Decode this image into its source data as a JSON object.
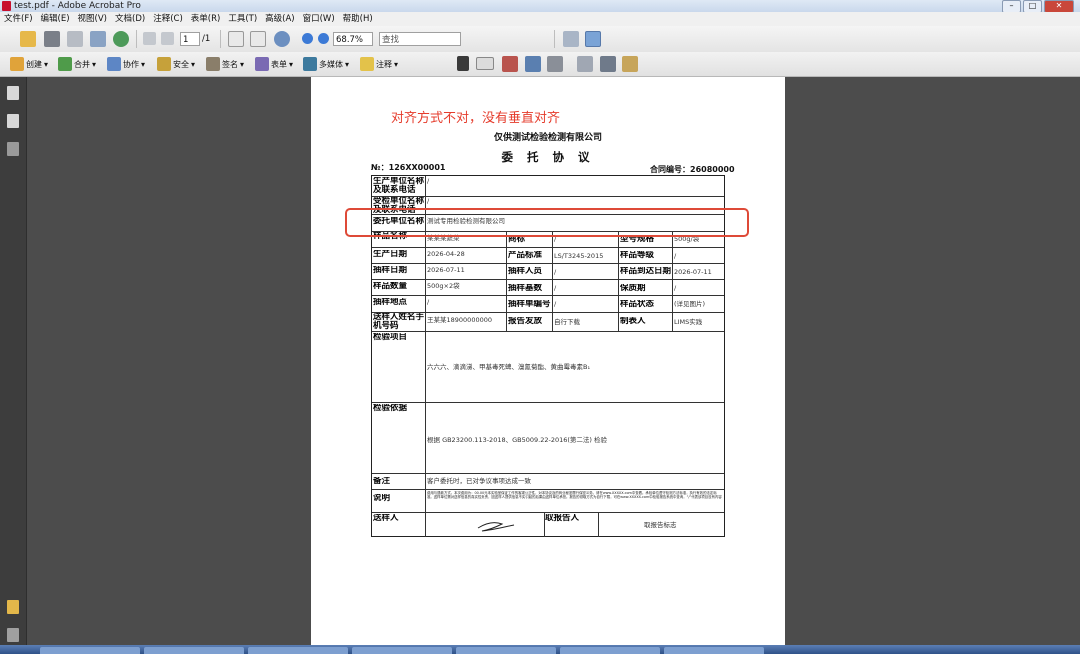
{
  "window": {
    "title": "test.pdf - Adobe Acrobat Pro",
    "minimize": "–",
    "maximize": "□",
    "close": "✕"
  },
  "menu": [
    "文件(F)",
    "编辑(E)",
    "视图(V)",
    "文档(D)",
    "注释(C)",
    "表单(R)",
    "工具(T)",
    "高级(A)",
    "窗口(W)",
    "帮助(H)"
  ],
  "toolbar": {
    "page_current": "1",
    "page_total": "/1",
    "zoom": "68.7%",
    "search_placeholder": "查找",
    "buttons": [
      "创建",
      "合并",
      "协作",
      "安全",
      "签名",
      "表单",
      "多媒体",
      "注释"
    ]
  },
  "annotation": "对齐方式不对，没有垂直对齐",
  "document": {
    "company": "仅供测试检验检测有限公司",
    "title": "委 托 协 议",
    "number": "№：126XX00001",
    "contract": "合同编号：26080000",
    "rows": {
      "producer": "生产单位名称及联系电话",
      "producer_val": "/",
      "inspected": "受检单位名称及联系电话",
      "inspected_val": "/",
      "client": "委托单位名称",
      "client_val": "测试专用检验检测有限公司",
      "sample_name": "样品名称",
      "sample_name_val": "某某某蔬菜",
      "trademark": "商标",
      "trademark_val": "/",
      "spec": "型号规格",
      "spec_val": "500g/袋",
      "prod_date": "生产日期",
      "prod_date_val": "2026-04-28",
      "standard": "产品标准",
      "standard_val": "LS/T3245-2015",
      "grade": "样品等级",
      "grade_val": "/",
      "sampling_date": "抽样日期",
      "sampling_date_val": "2026-07-11",
      "sampler": "抽样人员",
      "sampler_val": "/",
      "arrival": "样品到达日期",
      "arrival_val": "2026-07-11",
      "qty": "样品数量",
      "qty_val": "500g×2袋",
      "base": "抽样基数",
      "base_val": "/",
      "shelf": "保质期",
      "shelf_val": "/",
      "place": "抽样地点",
      "place_val": "/",
      "form_no": "抽样单编号",
      "form_no_val": "/",
      "state": "样品状态",
      "state_val": "(详见图片)",
      "sender_name": "送样人姓名手机号码",
      "sender_name_val": "王某某18900000000",
      "report": "报告发放",
      "report_val": "自行下载",
      "maker": "制表人",
      "maker_val": "LIMS实践",
      "items": "检验项目",
      "items_val": "六六六、滴滴涕、甲基毒死蜱、溴氰菊酯、黄曲霉毒素B₁",
      "basis": "检验依据",
      "basis_val": "根据 GB23200.113-2018、GB5009.22-2016(第二法) 检验",
      "remark": "备注",
      "remark_val": "客户委托时，已对争议事项达成一致",
      "note": "说明",
      "note_val": "费用与退款方式。本次费用为：00.00元本实验室保证工作的客观公正性，对本协议及的商业秘密履行保密义务。请在www.XXXXX.com中查看。承检单位遵守检测方法标准，执行有效的法定标准。送样单位需对送样信息的真实性负责，因送样人提供信息不实引起的后果由送样单位承担。报告的领取方式为自行下载，可在www.XXXXX.com中检验报告系统中查询，“/”代表该项目没有内容",
      "sender": "送样人",
      "receiver": "取报告人",
      "receiver_val": "取报告标志"
    }
  }
}
